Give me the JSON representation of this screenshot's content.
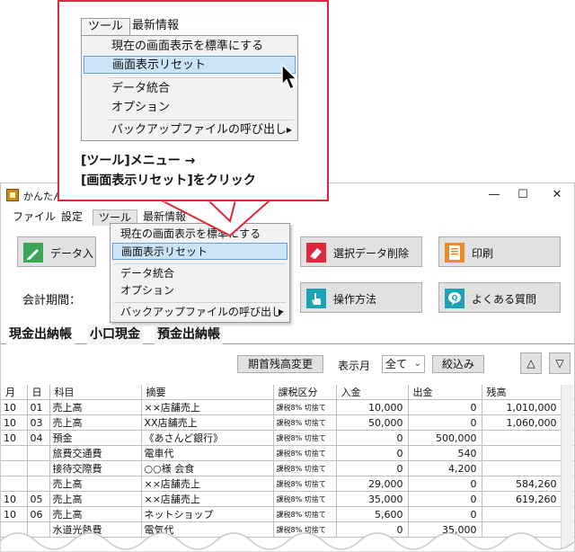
{
  "window": {
    "title": "かんたん",
    "controls": {
      "minimize": "—",
      "maximize": "☐",
      "close": "✕"
    }
  },
  "menubar": {
    "file": "ファイル",
    "settings": "設定",
    "tools": "ツール",
    "latest": "最新情報"
  },
  "toolbar": {
    "data_input": "データ入",
    "delete_selected": "選択データ削除",
    "print": "印刷",
    "how_to": "操作方法",
    "faq": "よくある質問"
  },
  "period_label": "会計期間：",
  "tabs": [
    "現金出納帳",
    "小口現金",
    "預金出納帳"
  ],
  "subbar": {
    "opening_balance_button": "期首残高変更",
    "month_label": "表示月",
    "month_value": "全て",
    "filter_button": "絞込み",
    "up_glyph": "△",
    "down_glyph": "▽"
  },
  "tools_menu": {
    "items": [
      "現在の画面表示を標準にする",
      "画面表示リセット",
      "データ統合",
      "オプション",
      "バックアップファイルの呼び出し"
    ],
    "submenu_glyph": "▶"
  },
  "grid": {
    "columns": [
      "月",
      "日",
      "科目",
      "摘要",
      "課税区分",
      "入金",
      "出金",
      "残高"
    ],
    "rows": [
      [
        "10",
        "01",
        "売上高",
        "××店舗売上",
        "課税8% 切捨て",
        "10,000",
        "0",
        "1,010,000"
      ],
      [
        "10",
        "03",
        "売上高",
        "XX店舗売上",
        "課税8% 切捨て",
        "50,000",
        "0",
        "1,060,000"
      ],
      [
        "10",
        "04",
        "預金",
        "《あさんど銀行》",
        "課税8% 切捨て",
        "0",
        "500,000",
        ""
      ],
      [
        "",
        "",
        "旅費交通費",
        "電車代",
        "課税8% 切捨て",
        "0",
        "540",
        ""
      ],
      [
        "",
        "",
        "接待交際費",
        "○○様 会食",
        "課税8% 切捨て",
        "0",
        "4,200",
        ""
      ],
      [
        "",
        "",
        "売上高",
        "××店舗売上",
        "課税8% 切捨て",
        "29,000",
        "0",
        "584,260"
      ],
      [
        "10",
        "05",
        "売上高",
        "××店舗売上",
        "課税8% 切捨て",
        "35,000",
        "0",
        "619,260"
      ],
      [
        "10",
        "06",
        "売上高",
        "ネットショップ",
        "課税8% 切捨て",
        "5,600",
        "0",
        ""
      ],
      [
        "",
        "",
        "水道光熱費",
        "電気代",
        "課税8% 切捨て",
        "0",
        "35,000",
        ""
      ]
    ]
  },
  "callout": {
    "menubar": {
      "tools": "ツール",
      "latest": "最新情報"
    },
    "items": [
      "現在の画面表示を標準にする",
      "画面表示リセット",
      "データ統合",
      "オプション",
      "バックアップファイルの呼び出し"
    ],
    "caption_line1": "[ツール]メニュー →",
    "caption_line2": "[画面表示リセット]をクリック"
  },
  "colors": {
    "accent_red": "#e0263a",
    "highlight": "#cce4f7"
  }
}
